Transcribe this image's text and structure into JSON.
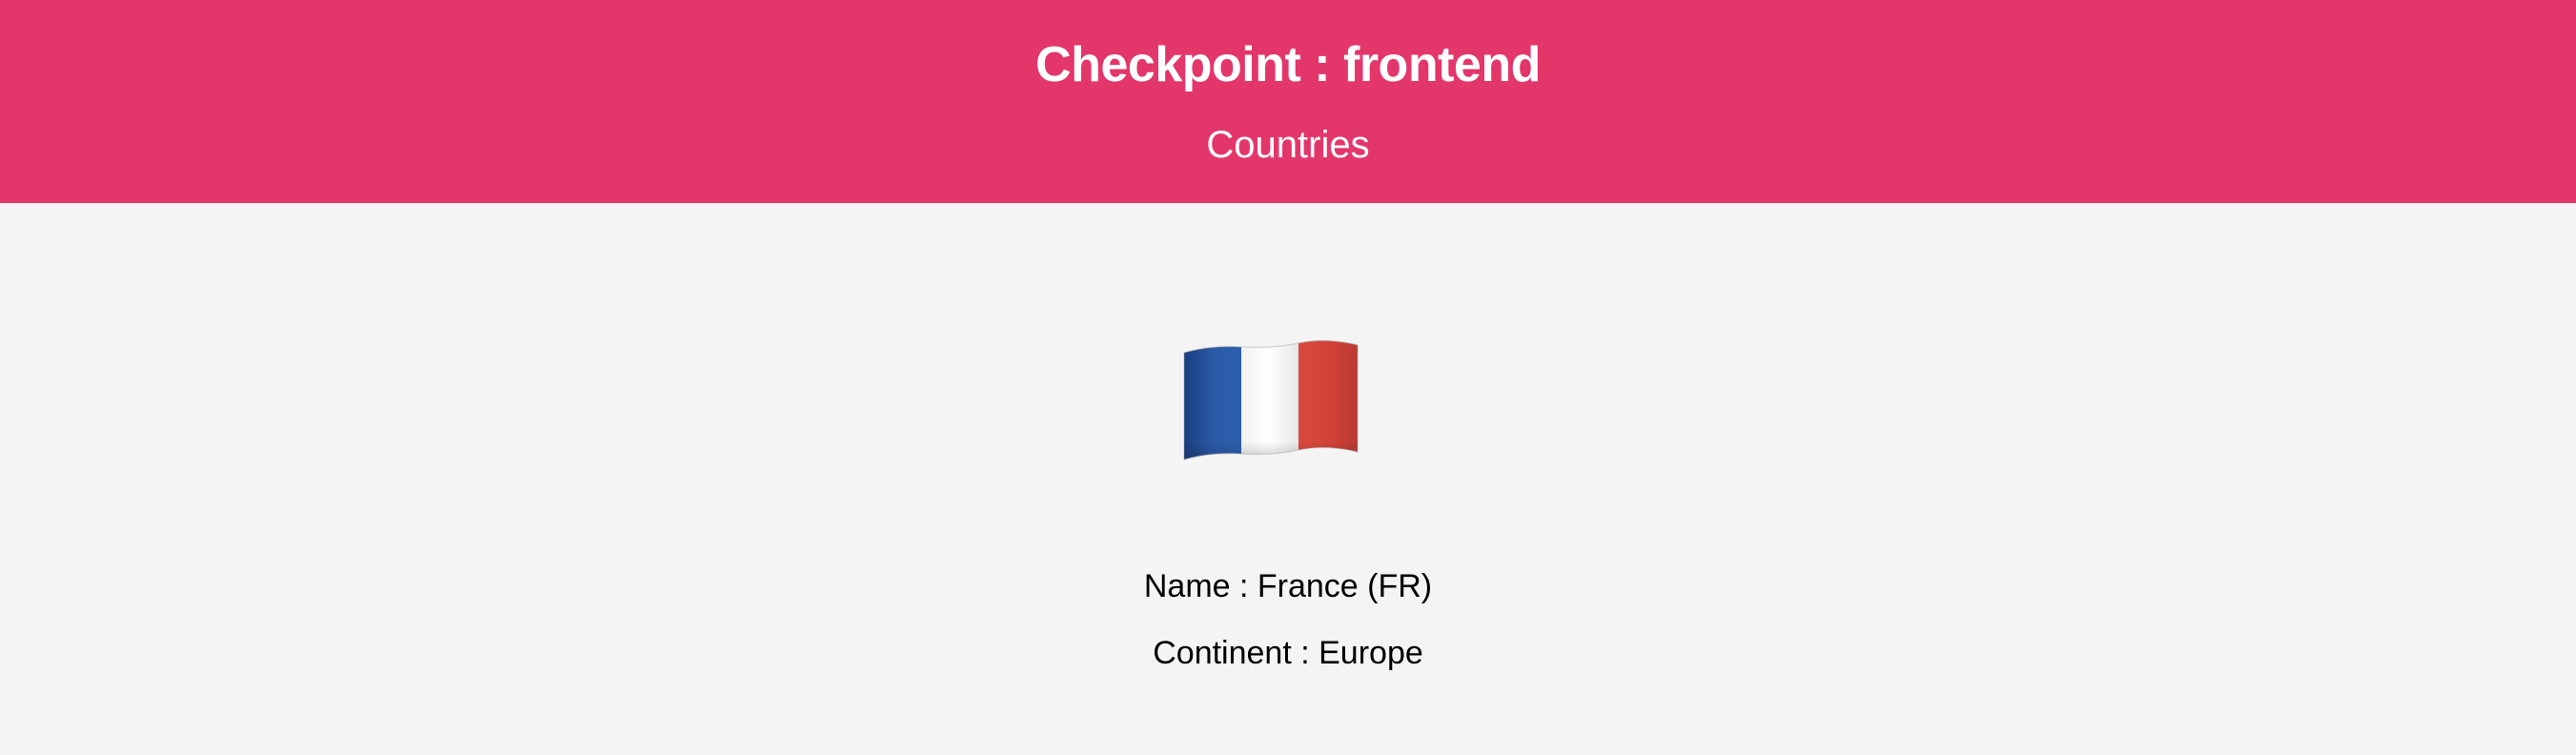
{
  "header": {
    "title": "Checkpoint : frontend",
    "subtitle": "Countries"
  },
  "country": {
    "flag_icon": "flag-france-icon",
    "name_line": "Name : France (FR)",
    "continent_line": "Continent : Europe"
  },
  "colors": {
    "header_background": "#e3366b",
    "page_background": "#f4f4f4",
    "flag_blue": "#1f4e96",
    "flag_white": "#ffffff",
    "flag_red": "#d8463a"
  }
}
